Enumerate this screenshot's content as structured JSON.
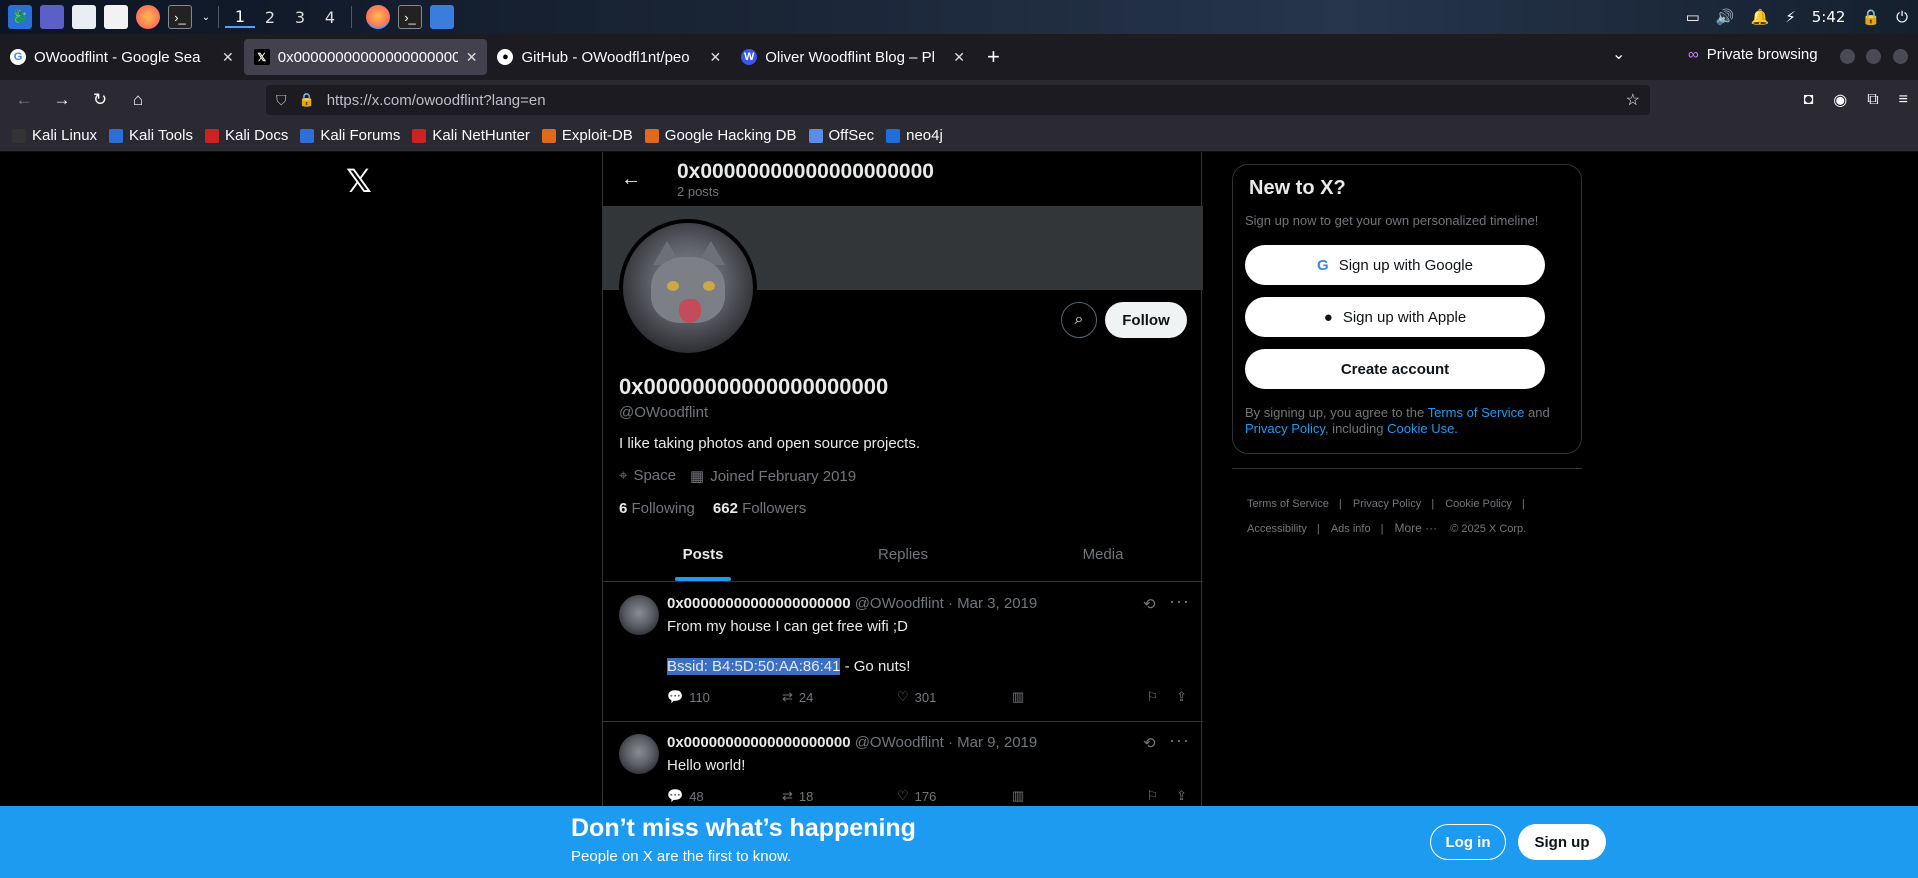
{
  "taskbar": {
    "workspaces": [
      "1",
      "2",
      "3",
      "4"
    ],
    "active_workspace": "1",
    "clock": "5:42"
  },
  "tabs": [
    {
      "title": "OWoodflint - Google Sea",
      "favicon": "google-icon",
      "active": false
    },
    {
      "title": "0x00000000000000000000",
      "favicon": "x-icon",
      "active": true
    },
    {
      "title": "GitHub - OWoodfl1nt/peo",
      "favicon": "github-icon",
      "active": false
    },
    {
      "title": "Oliver Woodflint Blog – Pl",
      "favicon": "wordpress-icon",
      "active": false
    }
  ],
  "private_label": "Private browsing",
  "url": "https://x.com/owoodflint?lang=en",
  "bookmarks": [
    "Kali Linux",
    "Kali Tools",
    "Kali Docs",
    "Kali Forums",
    "Kali NetHunter",
    "Exploit-DB",
    "Google Hacking DB",
    "OffSec",
    "neo4j"
  ],
  "profile": {
    "header_name": "0x00000000000000000000",
    "post_count": "2 posts",
    "display_name": "0x00000000000000000000",
    "handle": "@OWoodflint",
    "bio": "I like taking photos and open source projects.",
    "location": "Space",
    "joined": "Joined February 2019",
    "following_count": "6",
    "following_label": "Following",
    "followers_count": "662",
    "followers_label": "Followers",
    "follow_label": "Follow"
  },
  "profile_tabs": [
    "Posts",
    "Replies",
    "Media"
  ],
  "tweets": [
    {
      "name": "0x00000000000000000000",
      "handle_date": "@OWoodflint · Mar 3, 2019",
      "line1": "From my house I can get free wifi ;D",
      "highlight": "Bssid: B4:5D:50:AA:86:41",
      "line2_rest": " - Go nuts!",
      "replies": "110",
      "retweets": "24",
      "likes": "301"
    },
    {
      "name": "0x00000000000000000000",
      "handle_date": "@OWoodflint · Mar 9, 2019",
      "line1": "Hello world!",
      "replies": "48",
      "retweets": "18",
      "likes": "176"
    }
  ],
  "signup": {
    "title": "New to X?",
    "subtitle": "Sign up now to get your own personalized timeline!",
    "google": "Sign up with Google",
    "apple": "Sign up with Apple",
    "create": "Create account",
    "legal_prefix": "By signing up, you agree to the ",
    "tos": "Terms of Service",
    "and": " and ",
    "privacy": "Privacy Policy",
    "including": ", including ",
    "cookie": "Cookie Use."
  },
  "footer": [
    "Terms of Service",
    "Privacy Policy",
    "Cookie Policy",
    "Accessibility",
    "Ads info",
    "More ···",
    "© 2025 X Corp."
  ],
  "bottom_banner": {
    "title": "Don’t miss what’s happening",
    "subtitle": "People on X are the first to know.",
    "login": "Log in",
    "signup": "Sign up"
  },
  "colors": {
    "accent": "#1d9bf0",
    "highlight": "#3a6fc2"
  }
}
